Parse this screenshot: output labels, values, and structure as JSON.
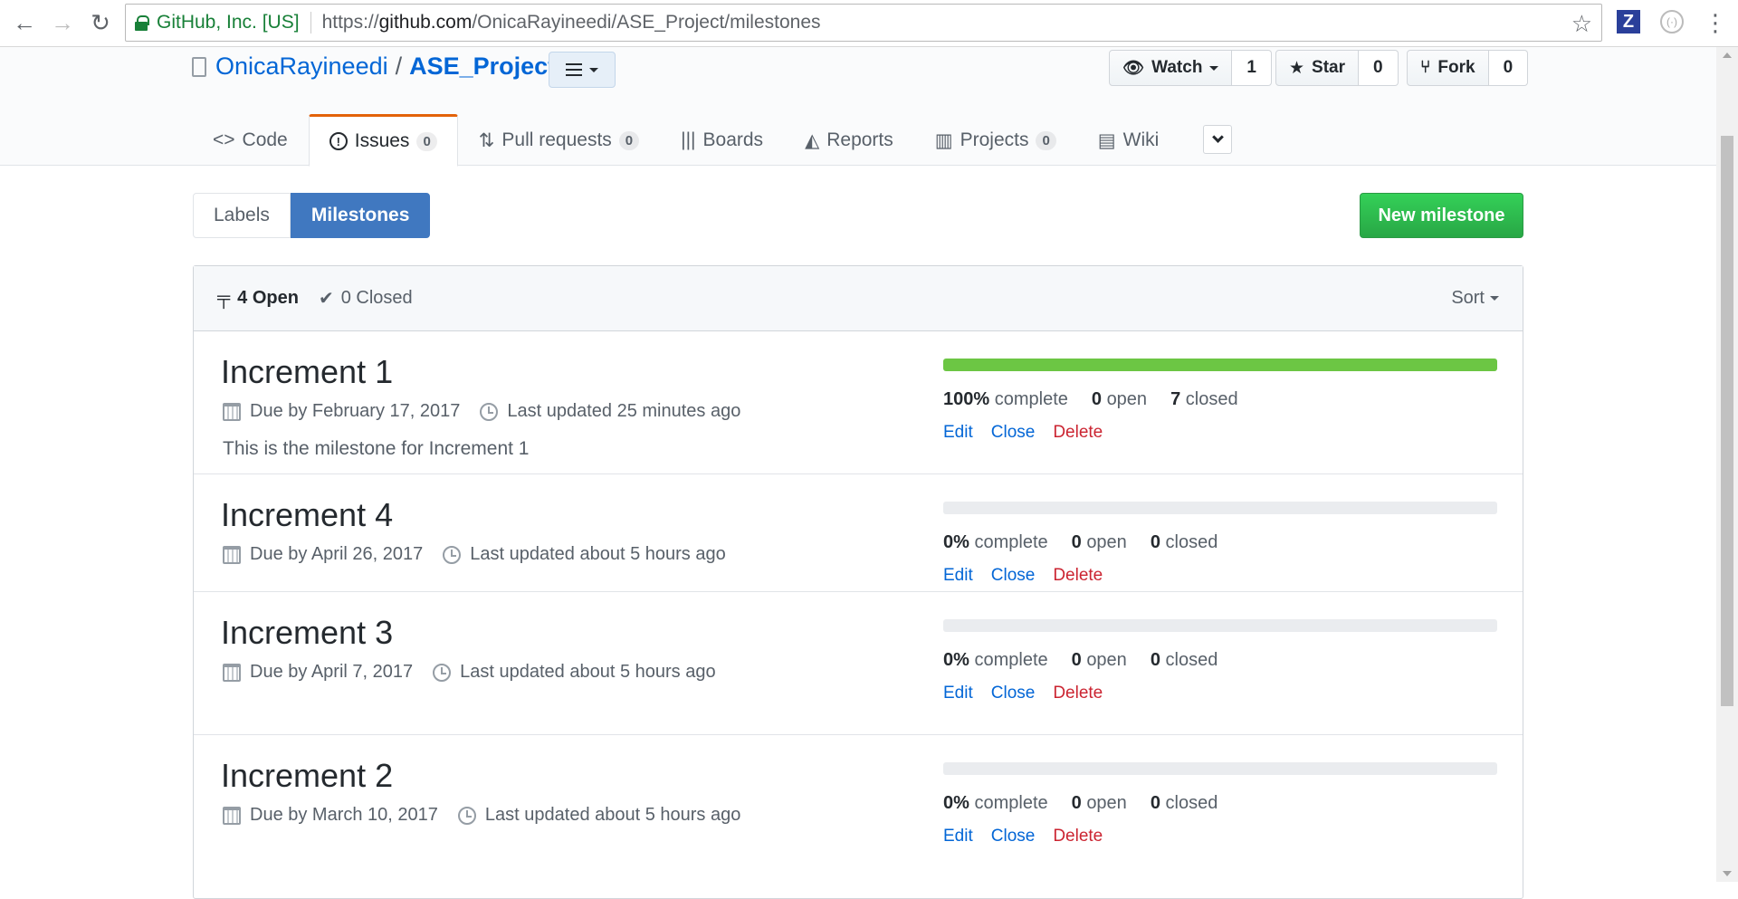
{
  "browser": {
    "secure_label": "GitHub, Inc. [US]",
    "url_prefix": "https://",
    "url_host": "github.com",
    "url_path": "/OnicaRayineedi/ASE_Project/milestones",
    "ext_z": "Z",
    "ext_c": "(·)"
  },
  "repo": {
    "owner": "OnicaRayineedi",
    "separator": "/",
    "name": "ASE_Project"
  },
  "actions": {
    "watch_label": "Watch",
    "watch_count": "1",
    "star_label": "Star",
    "star_count": "0",
    "fork_label": "Fork",
    "fork_count": "0"
  },
  "reponav": [
    {
      "label": "Code",
      "icon": "code-icon"
    },
    {
      "label": "Issues",
      "count": "0",
      "icon": "issue-icon"
    },
    {
      "label": "Pull requests",
      "count": "0",
      "icon": "pull-request-icon"
    },
    {
      "label": "Boards",
      "icon": "boards-icon"
    },
    {
      "label": "Reports",
      "icon": "reports-icon"
    },
    {
      "label": "Projects",
      "count": "0",
      "icon": "projects-icon"
    },
    {
      "label": "Wiki",
      "icon": "wiki-icon"
    }
  ],
  "subnav": {
    "labels": "Labels",
    "milestones": "Milestones",
    "new_milestone": "New milestone"
  },
  "filters": {
    "open_count_label": "4 Open",
    "closed_count_label": "0 Closed",
    "sort_label": "Sort"
  },
  "milestones": [
    {
      "title": "Increment 1",
      "due": "Due by February 17, 2017",
      "updated": "Last updated 25 minutes ago",
      "description": "This is the milestone for Increment 1",
      "percent": "100%",
      "progress": 100,
      "open": "0",
      "closed": "7"
    },
    {
      "title": "Increment 4",
      "due": "Due by April 26, 2017",
      "updated": "Last updated about 5 hours ago",
      "description": "",
      "percent": "0%",
      "progress": 0,
      "open": "0",
      "closed": "0"
    },
    {
      "title": "Increment 3",
      "due": "Due by April 7, 2017",
      "updated": "Last updated about 5 hours ago",
      "description": "",
      "percent": "0%",
      "progress": 0,
      "open": "0",
      "closed": "0"
    },
    {
      "title": "Increment 2",
      "due": "Due by March 10, 2017",
      "updated": "Last updated about 5 hours ago",
      "description": "",
      "percent": "0%",
      "progress": 0,
      "open": "0",
      "closed": "0"
    }
  ],
  "labels": {
    "complete": "complete",
    "open": "open",
    "closed": "closed",
    "edit": "Edit",
    "close": "Close",
    "delete": "Delete"
  },
  "colors": {
    "accent": "#4078c0",
    "progress": "#6cc644",
    "primary_button": "#28a745",
    "danger": "#cb2431",
    "tab_highlight": "#e36209"
  }
}
